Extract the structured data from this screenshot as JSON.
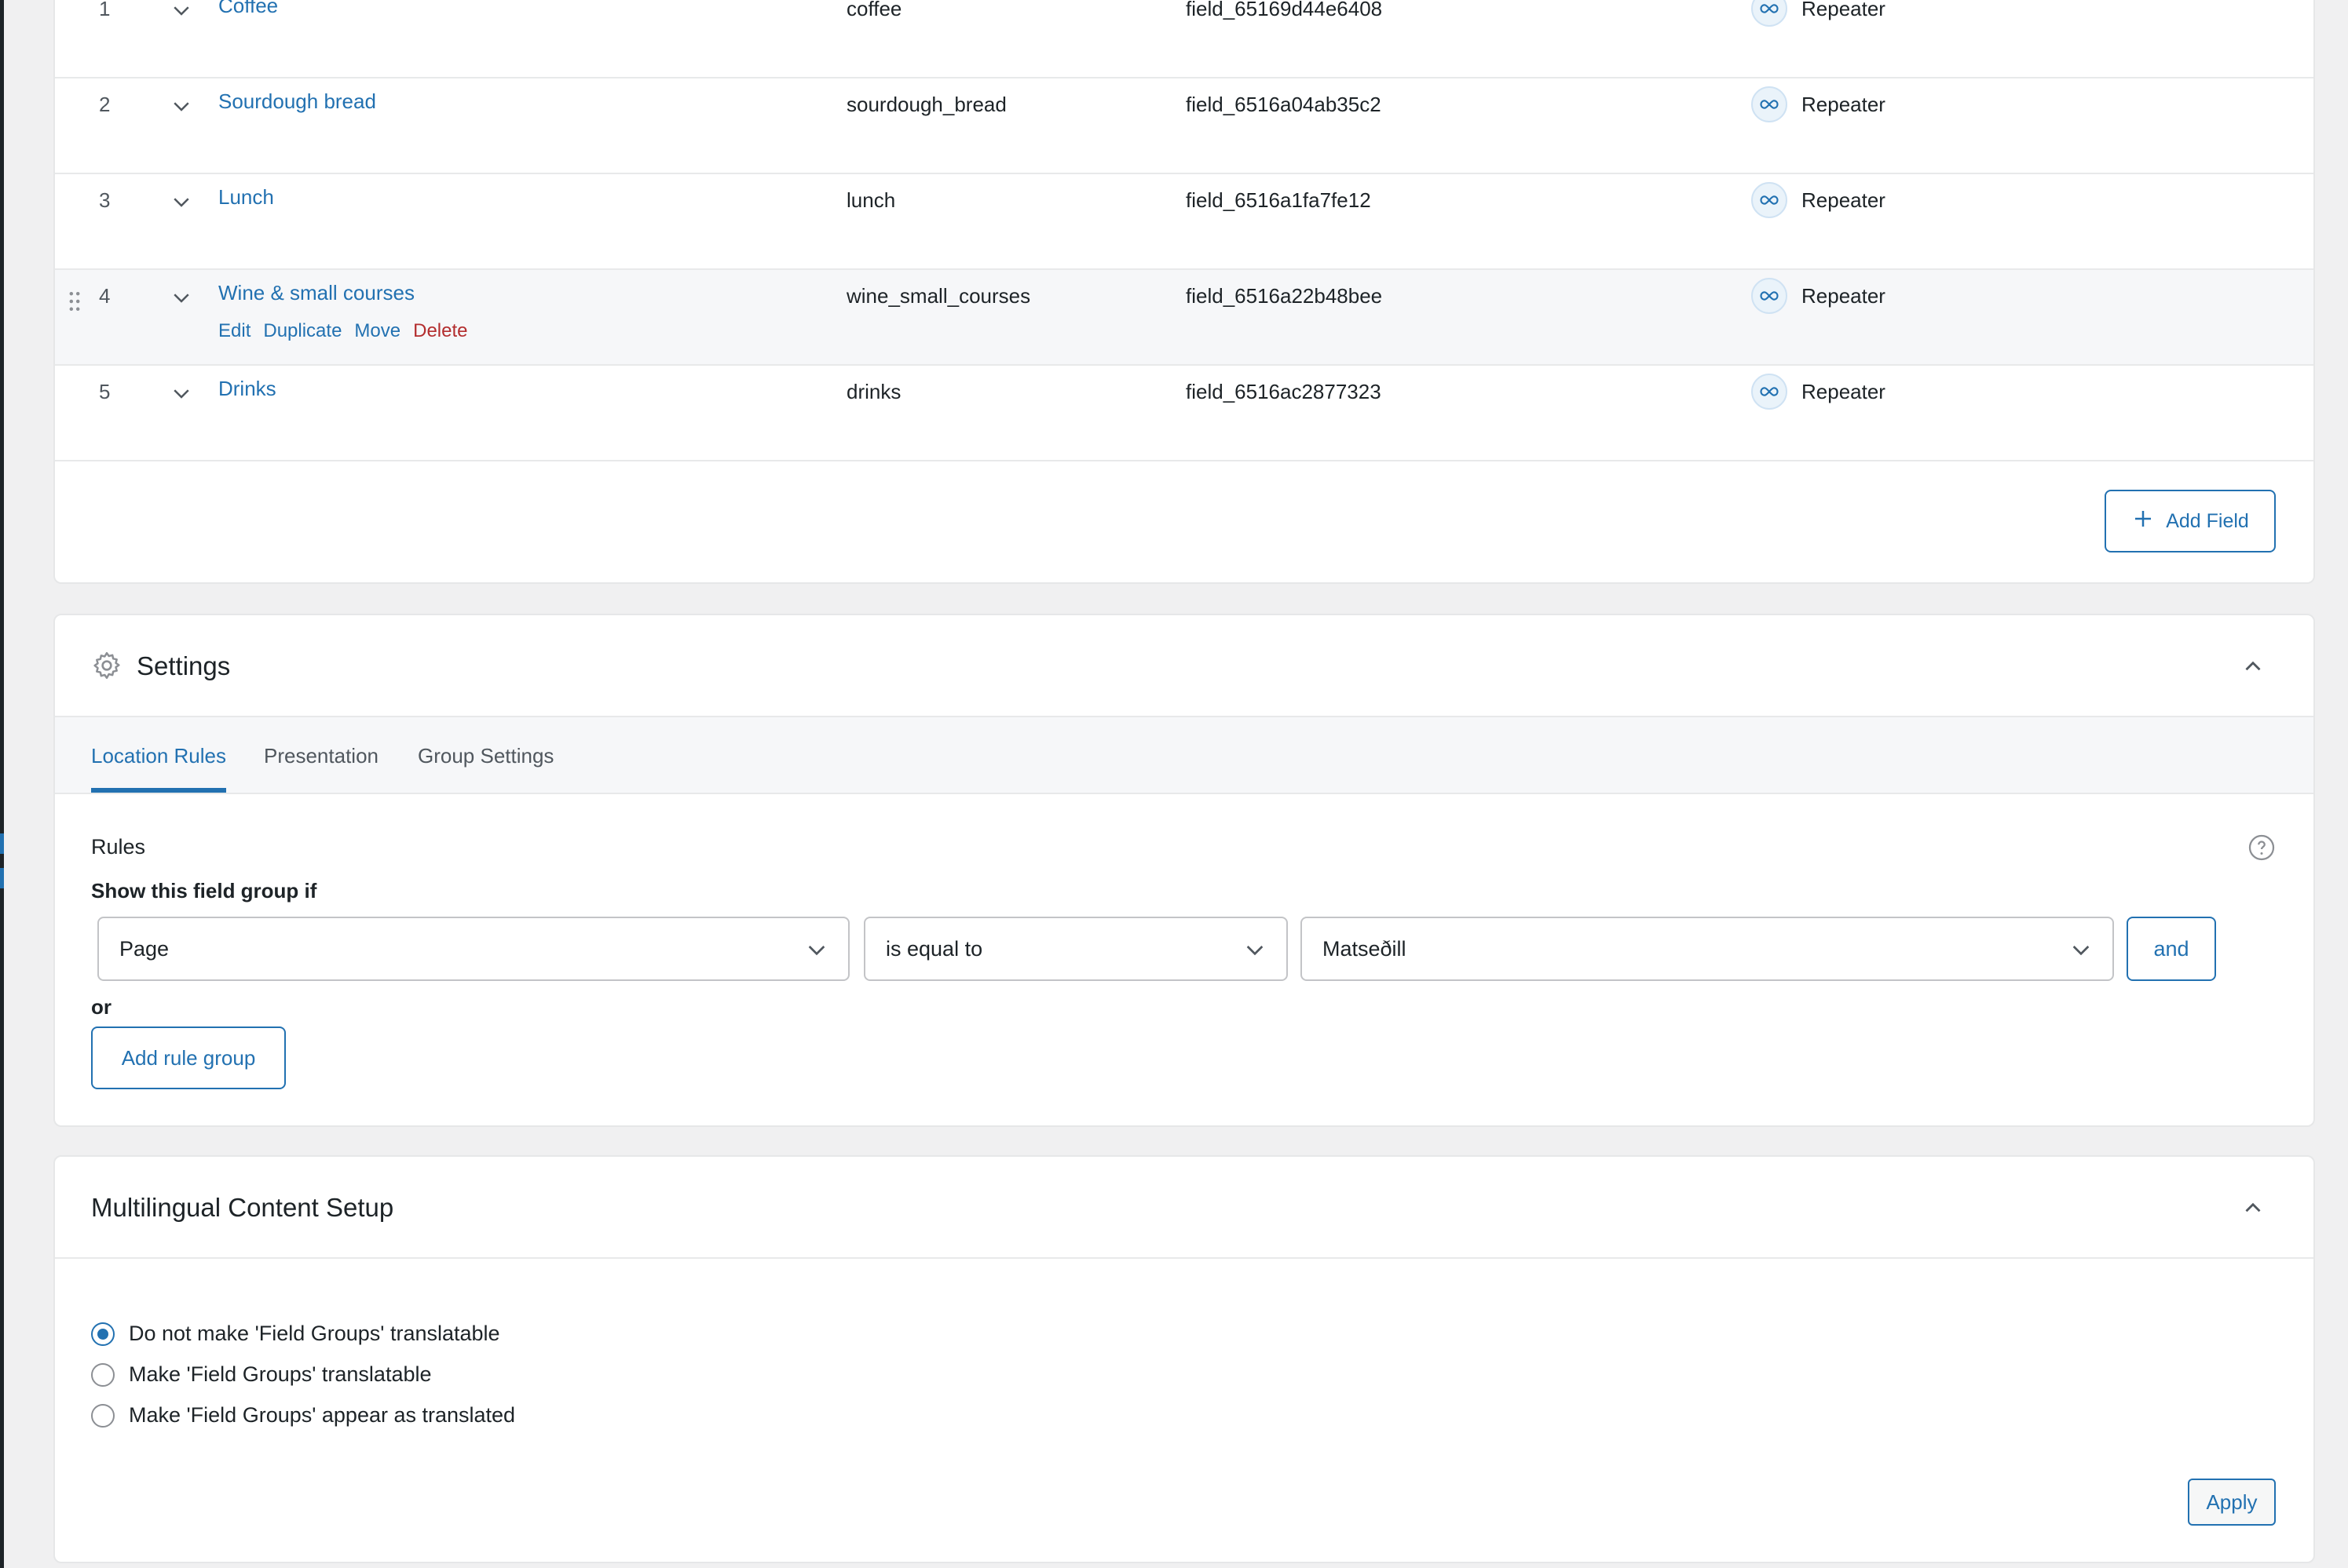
{
  "fields": [
    {
      "num": "1",
      "label": "Coffee",
      "name": "coffee",
      "key": "field_65169d44e6408",
      "type": "Repeater"
    },
    {
      "num": "2",
      "label": "Sourdough bread",
      "name": "sourdough_bread",
      "key": "field_6516a04ab35c2",
      "type": "Repeater"
    },
    {
      "num": "3",
      "label": "Lunch",
      "name": "lunch",
      "key": "field_6516a1fa7fe12",
      "type": "Repeater"
    },
    {
      "num": "4",
      "label": "Wine & small courses",
      "name": "wine_small_courses",
      "key": "field_6516a22b48bee",
      "type": "Repeater"
    },
    {
      "num": "5",
      "label": "Drinks",
      "name": "drinks",
      "key": "field_6516ac2877323",
      "type": "Repeater"
    }
  ],
  "row_actions": {
    "edit": "Edit",
    "duplicate": "Duplicate",
    "move": "Move",
    "delete": "Delete"
  },
  "add_field_label": "Add Field",
  "settings": {
    "title": "Settings",
    "tabs": [
      "Location Rules",
      "Presentation",
      "Group Settings"
    ],
    "rules_label": "Rules",
    "show_if_label": "Show this field group if",
    "rule": {
      "param": "Page",
      "operator": "is equal to",
      "value": "Matseðill"
    },
    "and_label": "and",
    "or_label": "or",
    "add_rule_group_label": "Add rule group"
  },
  "multilingual": {
    "title": "Multilingual Content Setup",
    "options": [
      "Do not make 'Field Groups' translatable",
      "Make 'Field Groups' translatable",
      "Make 'Field Groups' appear as translated"
    ],
    "selected_option": "Do not make 'Field Groups' translatable",
    "apply_label": "Apply"
  },
  "colors": {
    "accent": "#2271b1",
    "danger": "#b32d2e",
    "background": "#f0f0f1"
  }
}
